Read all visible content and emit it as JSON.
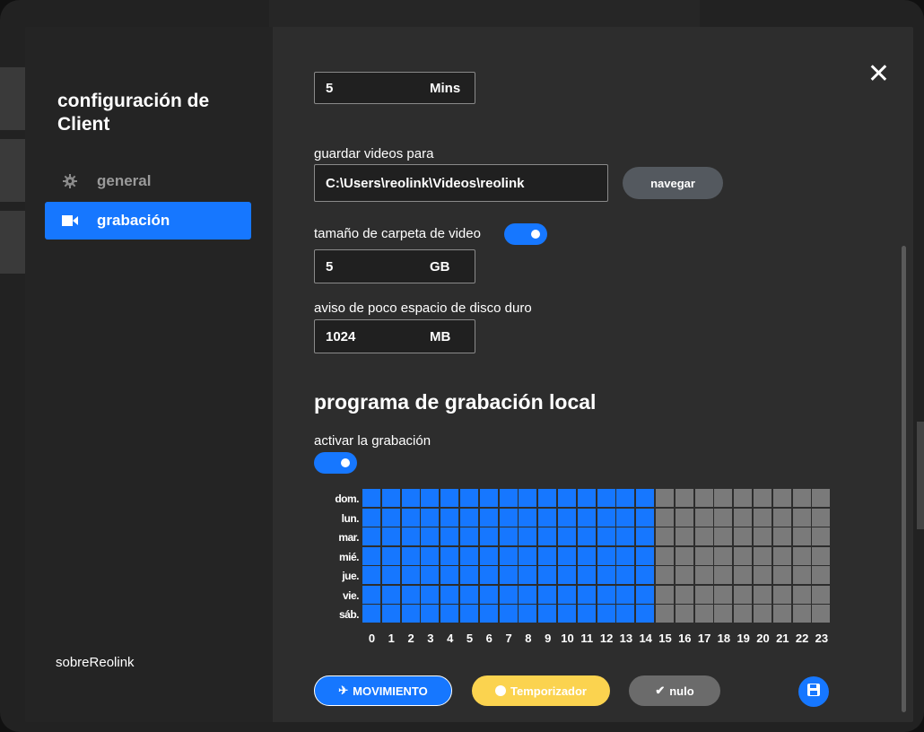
{
  "sidebar": {
    "title": "configuración de Client",
    "items": [
      {
        "label": "general",
        "icon": "gear-icon"
      },
      {
        "label": "grabación",
        "icon": "video-camera-icon"
      }
    ],
    "about": "sobreReolink"
  },
  "close_icon": "✕",
  "fields": {
    "top_partial": {
      "value": "5",
      "unit": "Mins"
    },
    "save_path_label": "guardar videos para",
    "save_path": "C:\\Users\\reolink\\Videos\\reolink",
    "browse": "navegar",
    "folder_size_label": "tamaño de carpeta de video",
    "folder_size": {
      "value": "5",
      "unit": "GB"
    },
    "low_space_label": "aviso de poco espacio de disco duro",
    "low_space": {
      "value": "1024",
      "unit": "MB"
    }
  },
  "schedule": {
    "title": "programa de grabación local",
    "enable_label": "activar la grabación",
    "days": [
      "dom.",
      "lun.",
      "mar.",
      "mié.",
      "jue.",
      "vie.",
      "sáb."
    ],
    "hours": [
      "0",
      "1",
      "2",
      "3",
      "4",
      "5",
      "6",
      "7",
      "8",
      "9",
      "10",
      "11",
      "12",
      "13",
      "14",
      "15",
      "16",
      "17",
      "18",
      "19",
      "20",
      "21",
      "22",
      "23"
    ],
    "active_until_hour": 14,
    "colors": {
      "active": "#1677ff",
      "inactive": "#7a7a7a"
    }
  },
  "buttons": {
    "motion": "MOVIMIENTO",
    "timer": "Temporizador",
    "null": "nulo"
  },
  "colors": {
    "accent": "#1677ff",
    "timer": "#fbd34f"
  }
}
